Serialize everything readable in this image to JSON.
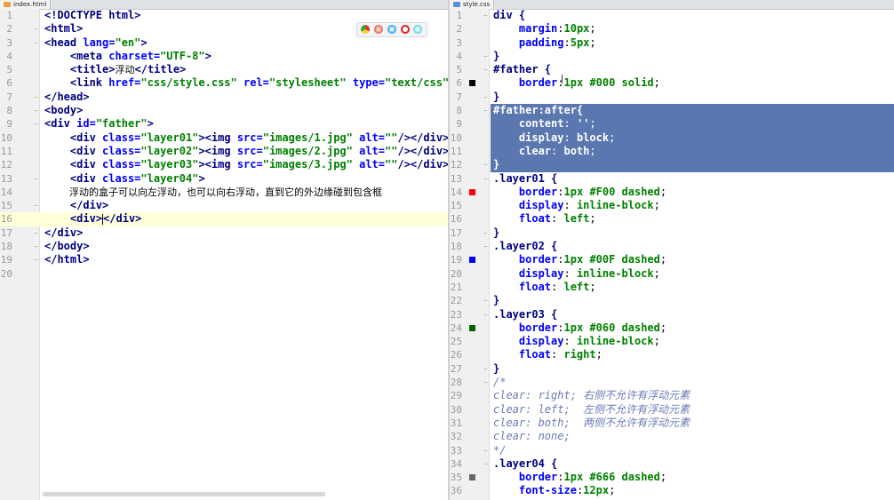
{
  "left_tab": {
    "label": "index.html"
  },
  "right_tab": {
    "label": "style.css"
  },
  "browser_icons": [
    "chrome-icon",
    "firefox-icon",
    "safari-icon",
    "opera-icon",
    "ie-icon"
  ],
  "html_lines": [
    [
      "1",
      "<!DOCTYPE html>"
    ],
    [
      "2",
      "<html>"
    ],
    [
      "3",
      "<head lang=\"en\">"
    ],
    [
      "4",
      "    <meta charset=\"UTF-8\">"
    ],
    [
      "5",
      "    <title>浮动</title>"
    ],
    [
      "6",
      "    <link href=\"css/style.css\" rel=\"stylesheet\" type=\"text/css\"/>"
    ],
    [
      "7",
      "</head>"
    ],
    [
      "8",
      "<body>"
    ],
    [
      "9",
      "<div id=\"father\">"
    ],
    [
      "10",
      "    <div class=\"layer01\"><img src=\"images/1.jpg\" alt=\"\"/></div>"
    ],
    [
      "11",
      "    <div class=\"layer02\"><img src=\"images/2.jpg\" alt=\"\"/></div>"
    ],
    [
      "12",
      "    <div class=\"layer03\"><img src=\"images/3.jpg\" alt=\"\"/></div>"
    ],
    [
      "13",
      "    <div class=\"layer04\">"
    ],
    [
      "14",
      "        浮动的盒子可以向左浮动，也可以向右浮动，直到它的外边缘碰到包含框"
    ],
    [
      "15",
      "    </div>"
    ],
    [
      "16",
      "    <div></div>"
    ],
    [
      "17",
      "</div>"
    ],
    [
      "18",
      "</body>"
    ],
    [
      "19",
      "</html>"
    ],
    [
      "20",
      ""
    ]
  ],
  "css_lines": [
    [
      "1",
      "div {"
    ],
    [
      "2",
      "    margin:10px;"
    ],
    [
      "3",
      "    padding:5px;"
    ],
    [
      "4",
      "}"
    ],
    [
      "5",
      "#father {"
    ],
    [
      "6",
      "    border:1px #000 solid;"
    ],
    [
      "7",
      "}"
    ],
    [
      "8",
      "#father:after{"
    ],
    [
      "9",
      "    content: '';"
    ],
    [
      "10",
      "    display: block;"
    ],
    [
      "11",
      "    clear: both;"
    ],
    [
      "12",
      "}"
    ],
    [
      "13",
      ".layer01 {"
    ],
    [
      "14",
      "    border:1px #F00 dashed;"
    ],
    [
      "15",
      "    display: inline-block;"
    ],
    [
      "16",
      "    float: left;"
    ],
    [
      "17",
      "}"
    ],
    [
      "18",
      ".layer02 {"
    ],
    [
      "19",
      "    border:1px #00F dashed;"
    ],
    [
      "20",
      "    display: inline-block;"
    ],
    [
      "21",
      "    float: left;"
    ],
    [
      "22",
      "}"
    ],
    [
      "23",
      ".layer03 {"
    ],
    [
      "24",
      "    border:1px #060 dashed;"
    ],
    [
      "25",
      "    display: inline-block;"
    ],
    [
      "26",
      "    float: right;"
    ],
    [
      "27",
      "}"
    ],
    [
      "28",
      "/*"
    ],
    [
      "29",
      "clear: right; 右侧不允许有浮动元素"
    ],
    [
      "30",
      "clear: left;  左侧不允许有浮动元素"
    ],
    [
      "31",
      "clear: both;  两侧不允许有浮动元素"
    ],
    [
      "32",
      "clear: none;"
    ],
    [
      "33",
      "*/"
    ],
    [
      "34",
      ".layer04 {"
    ],
    [
      "35",
      "    border:1px #666 dashed;"
    ],
    [
      "36",
      "    font-size:12px;"
    ]
  ],
  "swatches": {
    "line6": "#000000",
    "line14": "#ff0000",
    "line19": "#0000ff",
    "line24": "#006600",
    "line35": "#666666"
  },
  "colors": {
    "selection": "#5b77b0",
    "gutter": "#f0f0f0",
    "tag": "#000080",
    "attr": "#0000ff",
    "string": "#008000"
  }
}
